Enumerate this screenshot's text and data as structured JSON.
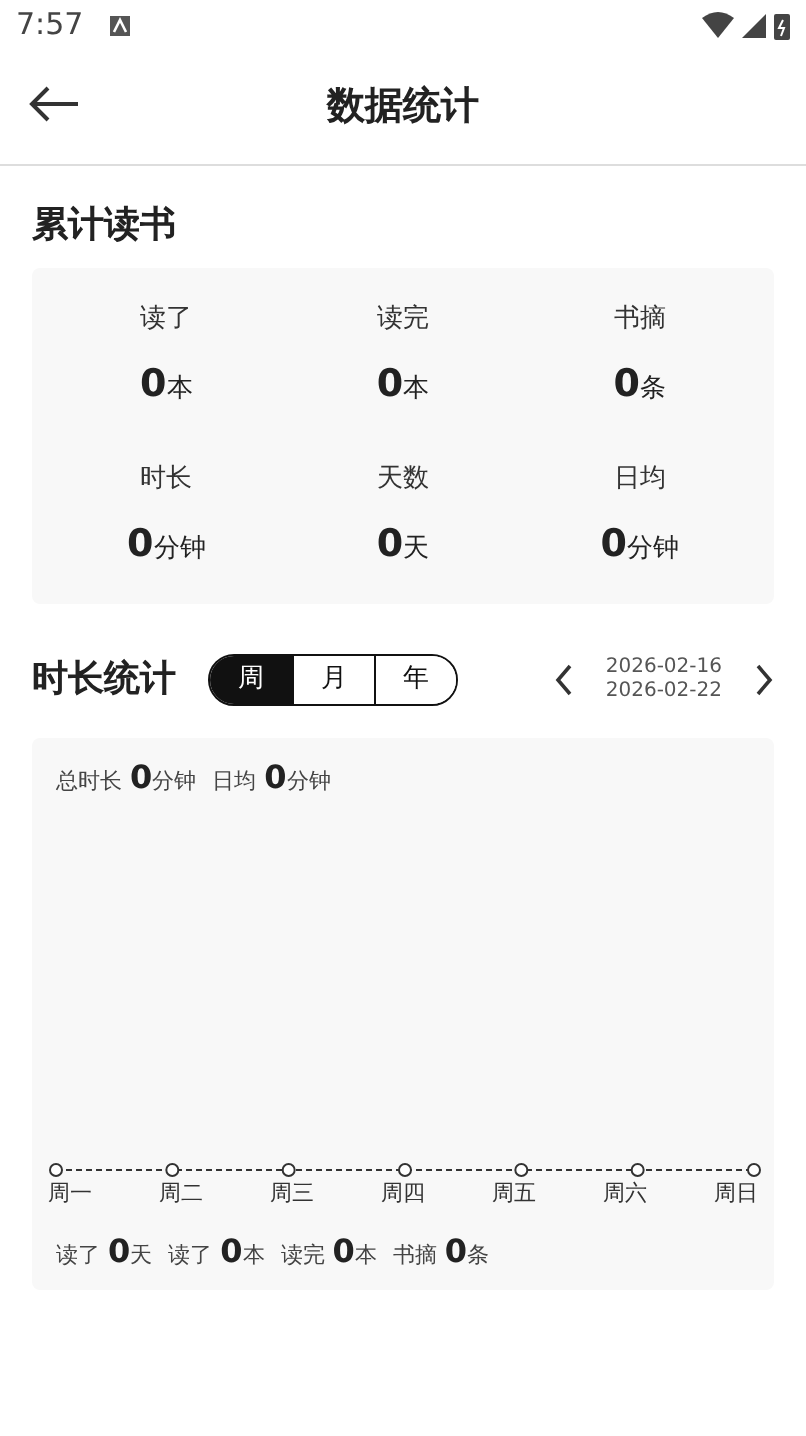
{
  "status_bar": {
    "time": "7:57"
  },
  "header": {
    "title": "数据统计"
  },
  "summary": {
    "title": "累计读书",
    "stats": [
      {
        "label": "读了",
        "value": "0",
        "unit": "本"
      },
      {
        "label": "读完",
        "value": "0",
        "unit": "本"
      },
      {
        "label": "书摘",
        "value": "0",
        "unit": "条"
      },
      {
        "label": "时长",
        "value": "0",
        "unit": "分钟"
      },
      {
        "label": "天数",
        "value": "0",
        "unit": "天"
      },
      {
        "label": "日均",
        "value": "0",
        "unit": "分钟"
      }
    ]
  },
  "duration": {
    "title": "时长统计",
    "periods": [
      {
        "label": "周",
        "selected": true
      },
      {
        "label": "月",
        "selected": false
      },
      {
        "label": "年",
        "selected": false
      }
    ],
    "range": {
      "start": "2026-02-16",
      "end": "2026-02-22"
    },
    "totals": [
      {
        "label": "总时长",
        "value": "0",
        "unit": "分钟"
      },
      {
        "label": "日均",
        "value": "0",
        "unit": "分钟"
      }
    ],
    "days": [
      "周一",
      "周二",
      "周三",
      "周四",
      "周五",
      "周六",
      "周日"
    ],
    "footer": [
      {
        "label": "读了",
        "value": "0",
        "unit": "天"
      },
      {
        "label": "读了",
        "value": "0",
        "unit": "本"
      },
      {
        "label": "读完",
        "value": "0",
        "unit": "本"
      },
      {
        "label": "书摘",
        "value": "0",
        "unit": "条"
      }
    ]
  }
}
